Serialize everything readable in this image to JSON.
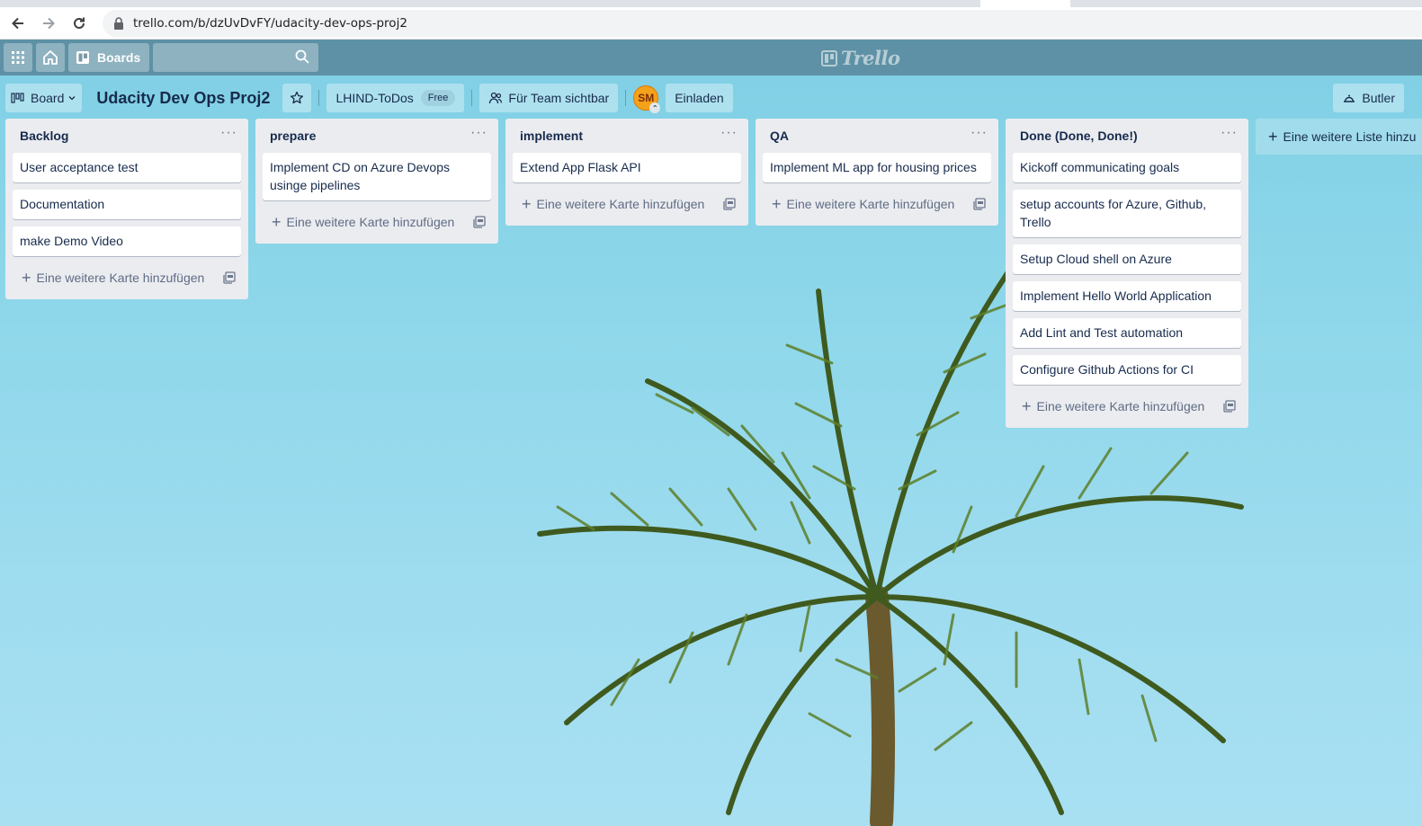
{
  "browser": {
    "url": "trello.com/b/dzUvDvFY/udacity-dev-ops-proj2"
  },
  "header": {
    "boards_label": "Boards",
    "logo_text": "Trello"
  },
  "board": {
    "switcher_label": "Board",
    "title": "Udacity Dev Ops Proj2",
    "team_name": "LHIND-ToDos",
    "team_badge": "Free",
    "visibility_label": "Für Team sichtbar",
    "member_initials": "SM",
    "invite_label": "Einladen",
    "butler_label": "Butler"
  },
  "lists": [
    {
      "title": "Backlog",
      "cards": [
        "User acceptance test",
        "Documentation",
        "make Demo Video"
      ],
      "add_label": "Eine weitere Karte hinzufügen"
    },
    {
      "title": "prepare",
      "cards": [
        "Implement CD on Azure Devops usinge pipelines"
      ],
      "add_label": "Eine weitere Karte hinzufügen"
    },
    {
      "title": "implement",
      "cards": [
        "Extend App Flask API"
      ],
      "add_label": "Eine weitere Karte hinzufügen"
    },
    {
      "title": "QA",
      "cards": [
        "Implement ML app for housing prices"
      ],
      "add_label": "Eine weitere Karte hinzufügen"
    },
    {
      "title": "Done (Done, Done!)",
      "cards": [
        "Kickoff communicating goals",
        "setup accounts for Azure, Github, Trello",
        "Setup Cloud shell on Azure",
        "Implement Hello World Application",
        "Add Lint and Test automation",
        "Configure Github Actions for CI"
      ],
      "add_label": "Eine weitere Karte hinzufügen"
    }
  ],
  "add_list_label": "Eine weitere Liste hinzu",
  "colors": {
    "sky": "#8ed7ea",
    "header_overlay": "#50788c",
    "list_bg": "#ebecf0",
    "avatar": "#f5a11a"
  }
}
